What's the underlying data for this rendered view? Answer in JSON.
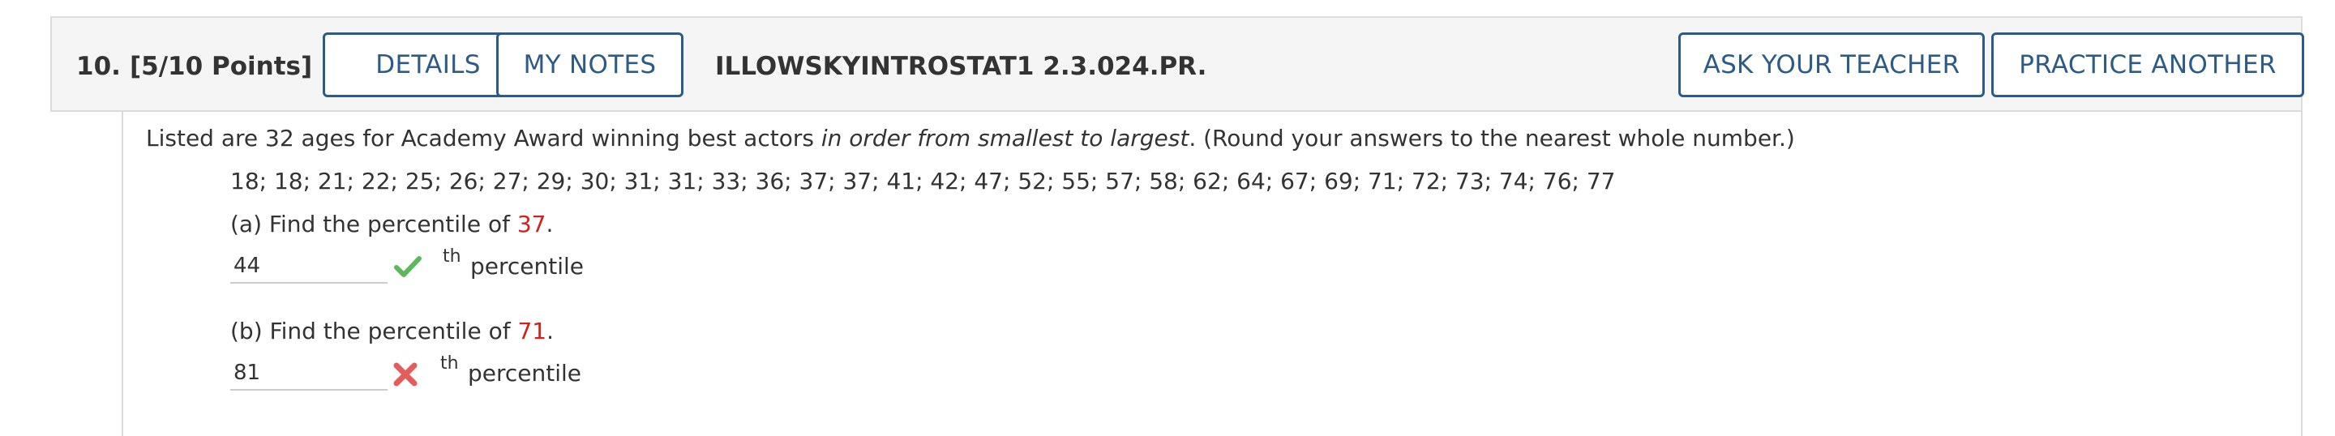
{
  "header": {
    "question_number": "10.",
    "points": "[5/10 Points]",
    "details_label": "DETAILS",
    "my_notes_label": "MY NOTES",
    "question_id": "ILLOWSKYINTROSTAT1 2.3.024.PR.",
    "ask_teacher_label": "ASK YOUR TEACHER",
    "practice_another_label": "PRACTICE ANOTHER"
  },
  "question": {
    "intro_before": "Listed are 32 ages for Academy Award winning best actors ",
    "intro_italic": "in order from smallest to largest",
    "intro_after": ". (Round your answers to the nearest whole number.)",
    "ages": "18; 18; 21; 22; 25; 26; 27; 29; 30; 31; 31; 33; 36; 37; 37; 41; 42; 47; 52; 55; 57; 58; 62; 64; 67; 69; 71; 72; 73; 74; 76; 77"
  },
  "part_a": {
    "prompt": "(a) Find the percentile of ",
    "value": "37",
    "period": ".",
    "answer": "44",
    "superscript": "th",
    "unit": "percentile",
    "status": "correct",
    "status_icon": "check-icon",
    "status_color": "#5cb85c"
  },
  "part_b": {
    "prompt": "(b) Find the percentile of ",
    "value": "71",
    "period": ".",
    "answer": "81",
    "superscript": "th",
    "unit": "percentile",
    "status": "incorrect",
    "status_icon": "cross-icon",
    "status_color": "#e35d5d"
  },
  "colors": {
    "button_border": "#2d5b86",
    "highlight_value": "#d2221e",
    "header_background": "#f5f5f5"
  }
}
